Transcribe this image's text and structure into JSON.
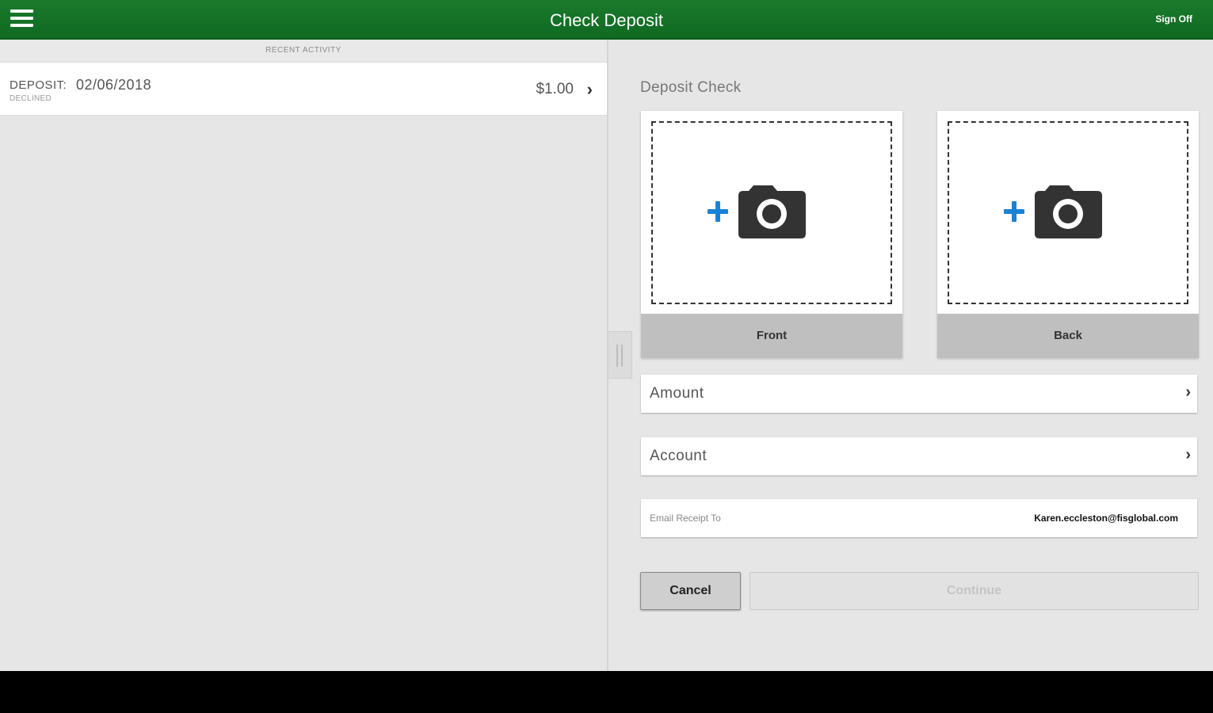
{
  "header": {
    "title": "Check Deposit",
    "signoff_label": "Sign Off"
  },
  "recent_activity": {
    "section_title": "RECENT ACTIVITY",
    "items": [
      {
        "type_label": "DEPOSIT:",
        "date": "02/06/2018",
        "status": "DECLINED",
        "amount": "$1.00"
      }
    ]
  },
  "deposit": {
    "title": "Deposit Check",
    "front_label": "Front",
    "back_label": "Back",
    "amount_label": "Amount",
    "account_label": "Account",
    "email_label": "Email Receipt To",
    "email_value": "Karen.eccleston@fisglobal.com",
    "cancel_label": "Cancel",
    "continue_label": "Continue"
  },
  "icons": {
    "menu": "hamburger-menu-icon",
    "camera": "camera-icon",
    "plus": "plus-icon",
    "chevron": "chevron-right-icon"
  },
  "colors": {
    "header_green": "#137326",
    "plus_blue": "#1a82d6"
  }
}
